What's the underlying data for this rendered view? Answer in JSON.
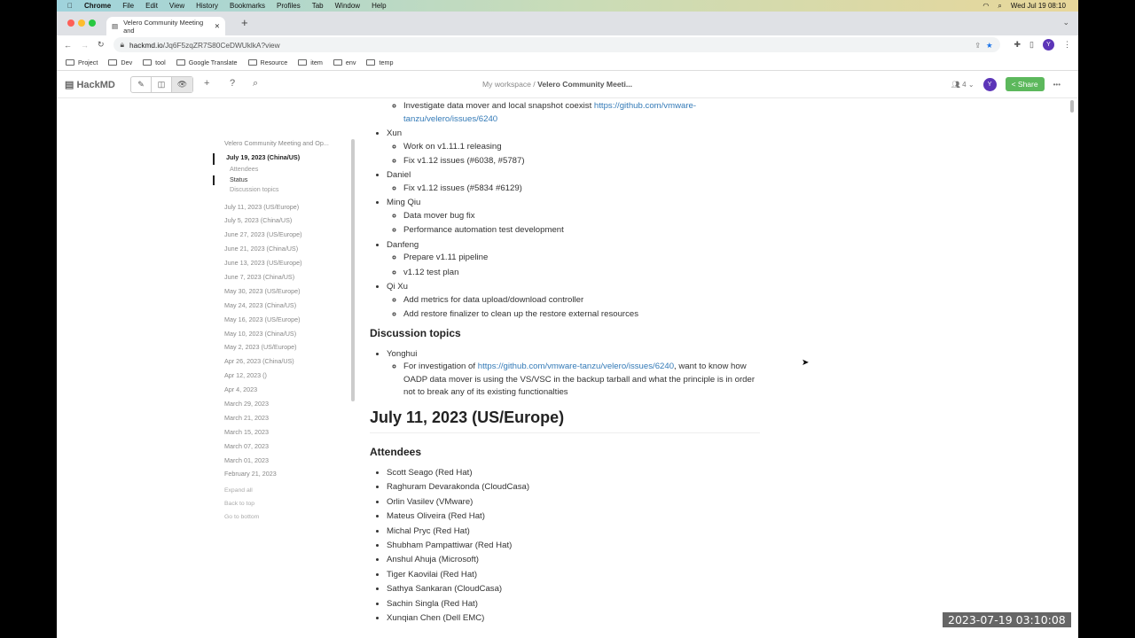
{
  "menubar": {
    "app": "Chrome",
    "items": [
      "File",
      "Edit",
      "View",
      "History",
      "Bookmarks",
      "Profiles",
      "Tab",
      "Window",
      "Help"
    ],
    "clock": "Wed Jul 19  08:10"
  },
  "tab": {
    "title": "Velero Community Meeting and"
  },
  "address": {
    "host": "hackmd.io",
    "path": "/Jq6F5zqZR7S80CeDWUklkA?view",
    "profile": "Y"
  },
  "bookmarks": [
    "Project",
    "Dev",
    "tool",
    "Google Translate",
    "Resource",
    "item",
    "env",
    "temp"
  ],
  "navbar": {
    "logo": "HackMD",
    "workspace": "My workspace /",
    "note_title": "Velero Community Meeti...",
    "online_count": "4",
    "avatar": "Y",
    "share": "Share"
  },
  "toc": {
    "title": "Velero Community Meeting and Op...",
    "current": "July 19, 2023 (China/US)",
    "subs": [
      "Attendees",
      "Status",
      "Discussion topics"
    ],
    "items": [
      "July 11, 2023 (US/Europe)",
      "July 5, 2023 (China/US)",
      "June 27, 2023 (US/Europe)",
      "June 21, 2023 (China/US)",
      "June 13, 2023 (US/Europe)",
      "June 7, 2023 (China/US)",
      "May 30, 2023 (US/Europe)",
      "May 24, 2023 (China/US)",
      "May 16, 2023 (US/Europe)",
      "May 10, 2023 (China/US)",
      "May 2, 2023 (US/Europe)",
      "Apr 26, 2023 (China/US)",
      "Apr 12, 2023 ()",
      "Apr 4, 2023",
      "March 29, 2023",
      "March 21, 2023",
      "March 15, 2023",
      "March 07, 2023",
      "March 01, 2023",
      "February 21, 2023"
    ],
    "footer": [
      "Expand all",
      "Back to top",
      "Go to bottom"
    ]
  },
  "doc": {
    "top_sub": {
      "text": "Investigate data mover and local snapshot coexist ",
      "link": "https://github.com/vmware-tanzu/velero/issues/6240"
    },
    "status": [
      {
        "name": "Xun",
        "items": [
          "Work on v1.11.1 releasing",
          "Fix v1.12 issues (#6038, #5787)"
        ]
      },
      {
        "name": "Daniel",
        "items": [
          "Fix v1.12 issues (#5834 #6129)"
        ]
      },
      {
        "name": "Ming Qiu",
        "items": [
          "Data mover bug fix",
          "Performance automation test development"
        ]
      },
      {
        "name": "Danfeng",
        "items": [
          "Prepare v1.11 pipeline",
          "v1.12 test plan"
        ]
      },
      {
        "name": "Qi Xu",
        "items": [
          "Add metrics for data upload/download controller",
          "Add restore finalizer to clean up the restore external resources"
        ]
      }
    ],
    "discussion_heading": "Discussion topics",
    "discussion": {
      "name": "Yonghui",
      "pre": "For investigation of ",
      "link": "https://github.com/vmware-tanzu/velero/issues/6240",
      "post": ", want to know how OADP data mover is using the VS/VSC in the backup tarball and what the principle is in order not to break any of its existing functionalties"
    },
    "section2_title": "July 11, 2023 (US/Europe)",
    "attendees_heading": "Attendees",
    "attendees": [
      "Scott Seago (Red Hat)",
      "Raghuram Devarakonda (CloudCasa)",
      "Orlin Vasilev (VMware)",
      "Mateus Oliveira (Red Hat)",
      "Michal Pryc (Red Hat)",
      "Shubham Pampattiwar (Red Hat)",
      "Anshul Ahuja (Microsoft)",
      "Tiger Kaovilai (Red Hat)",
      "Sathya Sankaran (CloudCasa)",
      "Sachin Singla (Red Hat)",
      "Xunqian Chen (Dell EMC)"
    ]
  },
  "timestamp": "2023-07-19 03:10:08",
  "colors": {
    "share": "#5cb85c",
    "link": "#337ab7",
    "avatar": "#5c35b8"
  }
}
